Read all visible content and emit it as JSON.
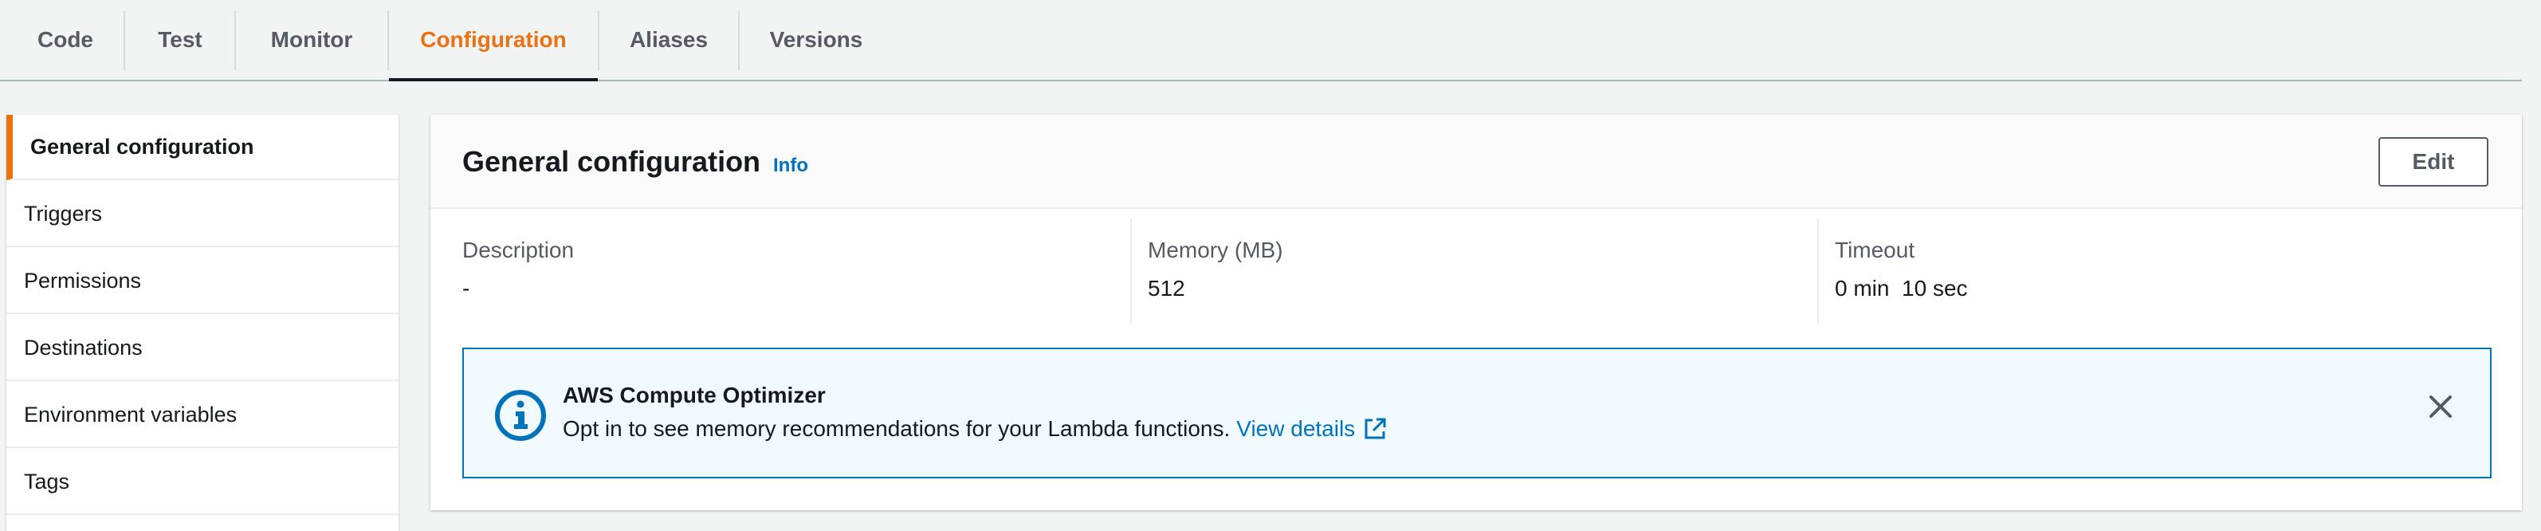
{
  "tabs": [
    {
      "label": "Code",
      "active": false
    },
    {
      "label": "Test",
      "active": false
    },
    {
      "label": "Monitor",
      "active": false
    },
    {
      "label": "Configuration",
      "active": true
    },
    {
      "label": "Aliases",
      "active": false
    },
    {
      "label": "Versions",
      "active": false
    }
  ],
  "sidenav": {
    "items": [
      {
        "label": "General configuration",
        "active": true
      },
      {
        "label": "Triggers",
        "active": false
      },
      {
        "label": "Permissions",
        "active": false
      },
      {
        "label": "Destinations",
        "active": false
      },
      {
        "label": "Environment variables",
        "active": false
      },
      {
        "label": "Tags",
        "active": false
      }
    ]
  },
  "panel": {
    "title": "General configuration",
    "info_label": "Info",
    "edit_label": "Edit",
    "fields": [
      {
        "label": "Description",
        "value": "-"
      },
      {
        "label": "Memory (MB)",
        "value": "512"
      },
      {
        "label": "Timeout",
        "value": "0 min  10 sec"
      }
    ]
  },
  "alert": {
    "title": "AWS Compute Optimizer",
    "message": "Opt in to see memory recommendations for your Lambda functions.",
    "link_label": "View details",
    "icons": {
      "status": "info-icon",
      "link": "external-link-icon",
      "dismiss": "close-icon"
    }
  },
  "colors": {
    "accent_orange": "#ec7211",
    "link_blue": "#0073bb",
    "text": "#16191f",
    "muted_text": "#545b64",
    "alert_background": "#f1faff",
    "page_background": "#f2f3f3"
  }
}
